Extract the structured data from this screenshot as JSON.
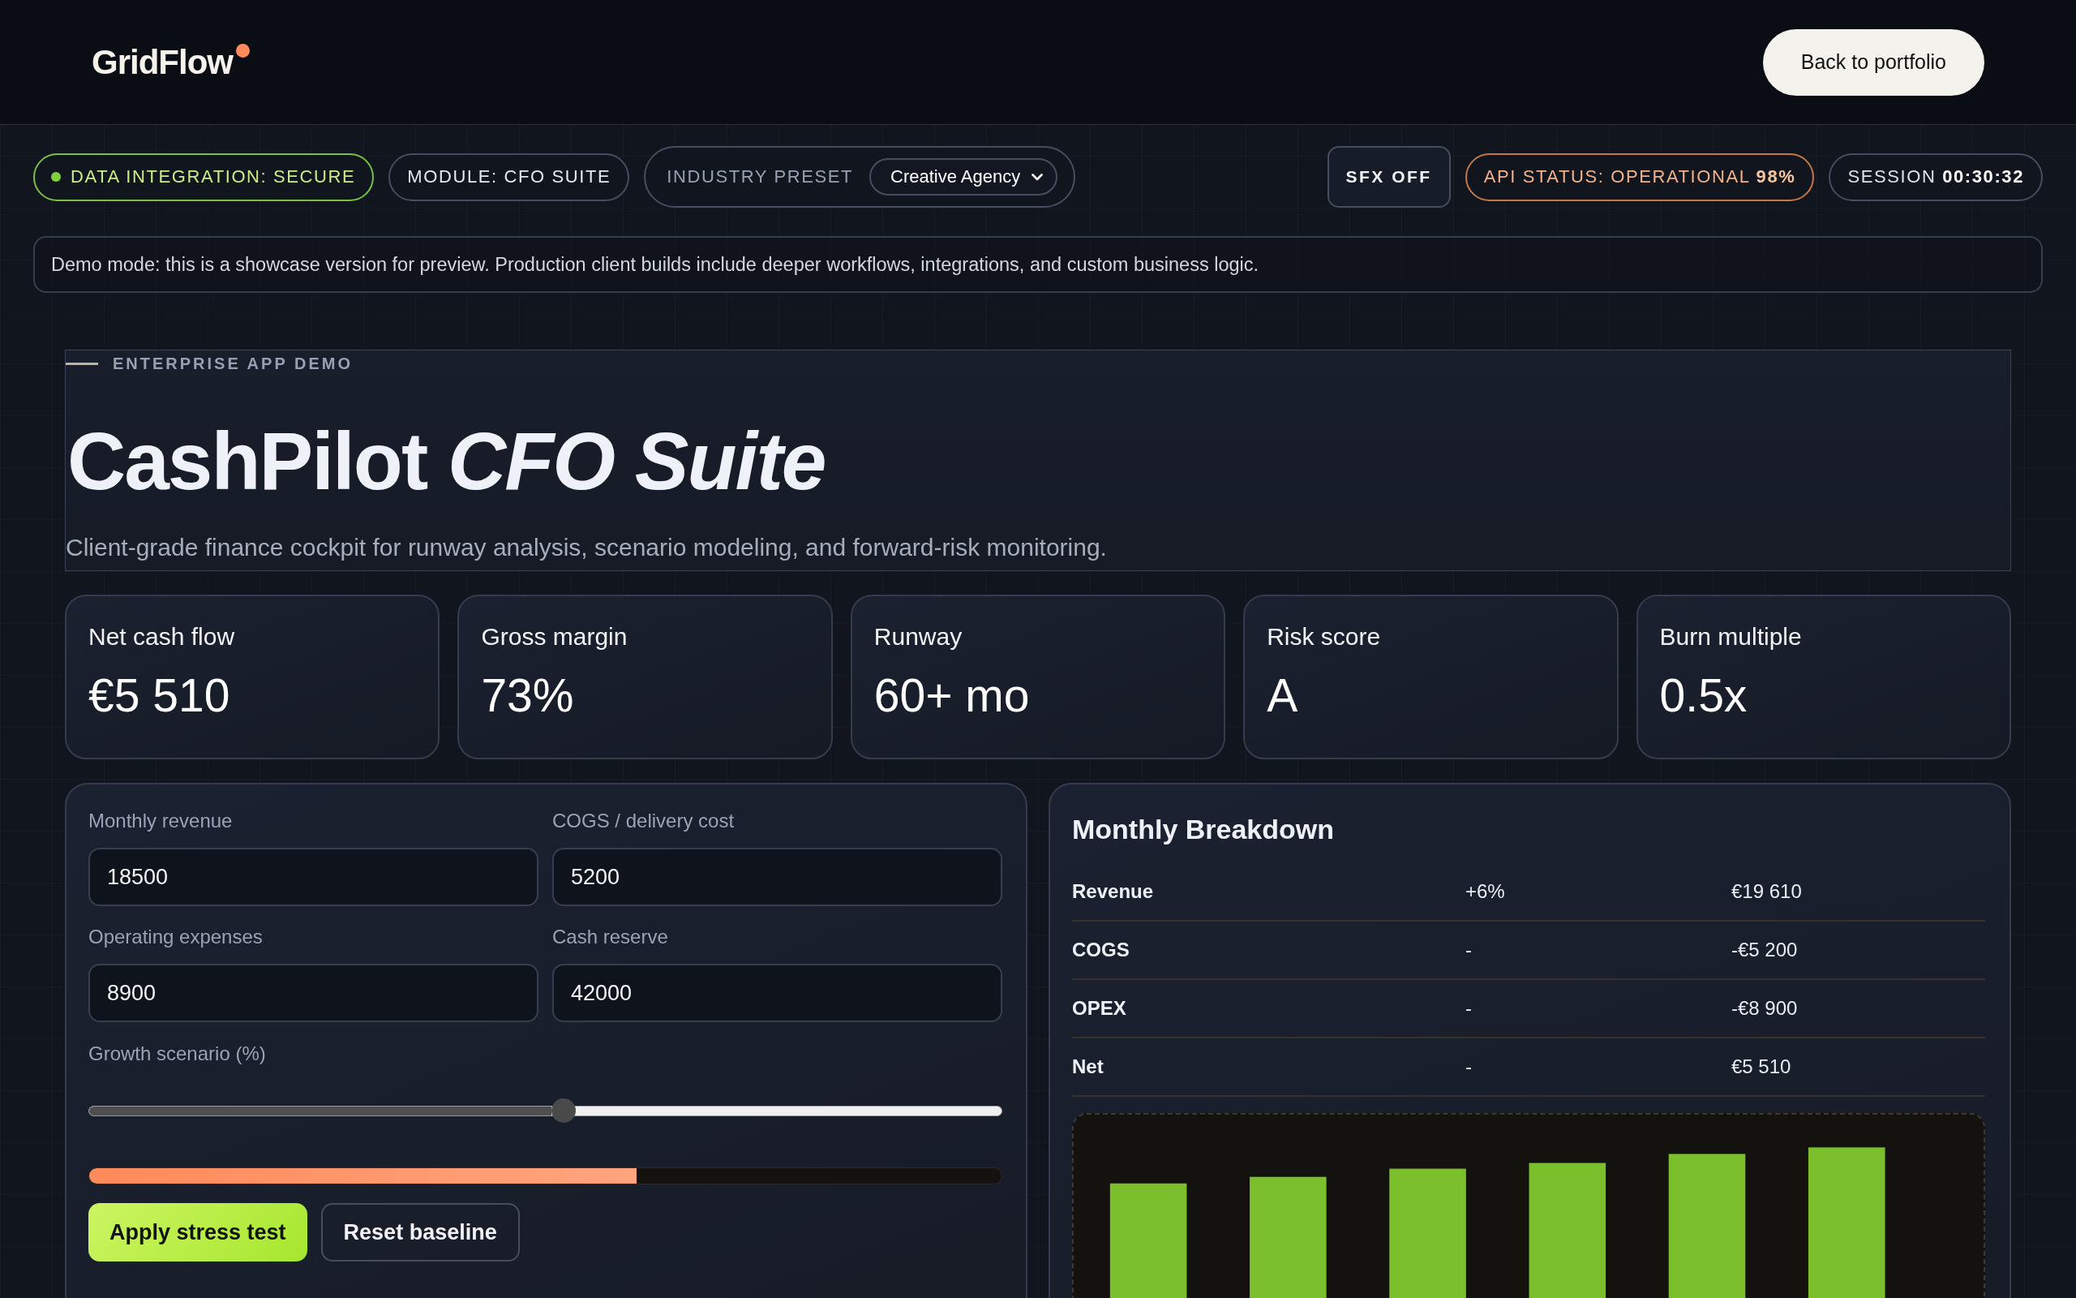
{
  "header": {
    "logo": "GridFlow",
    "back_button": "Back to portfolio"
  },
  "status_bar": {
    "left": [
      {
        "kind": "integration",
        "label": "DATA INTEGRATION: SECURE"
      },
      {
        "kind": "module",
        "label": "MODULE: CFO SUITE"
      },
      {
        "kind": "preset",
        "label": "INDUSTRY PRESET",
        "value": "Creative Agency"
      }
    ],
    "right": [
      {
        "kind": "toggle",
        "label": "SFX OFF"
      },
      {
        "kind": "api",
        "label": "API STATUS: OPERATIONAL **98%**"
      },
      {
        "kind": "session",
        "label": "SESSION **00:30:32**"
      }
    ]
  },
  "notice": "Demo mode: this is a showcase version for preview. Production client builds include deeper workflows, integrations, and custom business logic.",
  "hero": {
    "eyebrow": "ENTERPRISE APP DEMO",
    "title": "CashPilot *CFO Suite*",
    "subtitle": "Client-grade finance cockpit for runway analysis, scenario modeling, and forward-risk monitoring."
  },
  "kpis": [
    {
      "label": "Net cash flow",
      "value": "€5 510"
    },
    {
      "label": "Gross margin",
      "value": "73%"
    },
    {
      "label": "Runway",
      "value": "60+ mo"
    },
    {
      "label": "Risk score",
      "value": "A"
    },
    {
      "label": "Burn multiple",
      "value": "0.5x"
    }
  ],
  "inputs": {
    "fields": [
      {
        "label": "Monthly revenue",
        "value": "18500"
      },
      {
        "label": "COGS / delivery cost",
        "value": "5200"
      },
      {
        "label": "Operating expenses",
        "value": "8900"
      },
      {
        "label": "Cash reserve",
        "value": "42000"
      }
    ],
    "slider": {
      "label": "Growth scenario (%)",
      "level": 0.52
    },
    "progress": {
      "level": 0.6
    },
    "buttons": [
      {
        "kind": "primary",
        "label": "Apply stress test"
      },
      {
        "kind": "secondary",
        "label": "Reset baseline"
      }
    ]
  },
  "breakdown": {
    "title": "Monthly Breakdown",
    "rows": [
      {
        "label": "Revenue",
        "change": "+6%",
        "amount": "€19 610"
      },
      {
        "label": "COGS",
        "change": "-",
        "amount": "-€5 200"
      },
      {
        "label": "OPEX",
        "change": "-",
        "amount": "-€8 900"
      },
      {
        "label": "Net",
        "change": "-",
        "amount": "€5 510"
      }
    ]
  }
}
